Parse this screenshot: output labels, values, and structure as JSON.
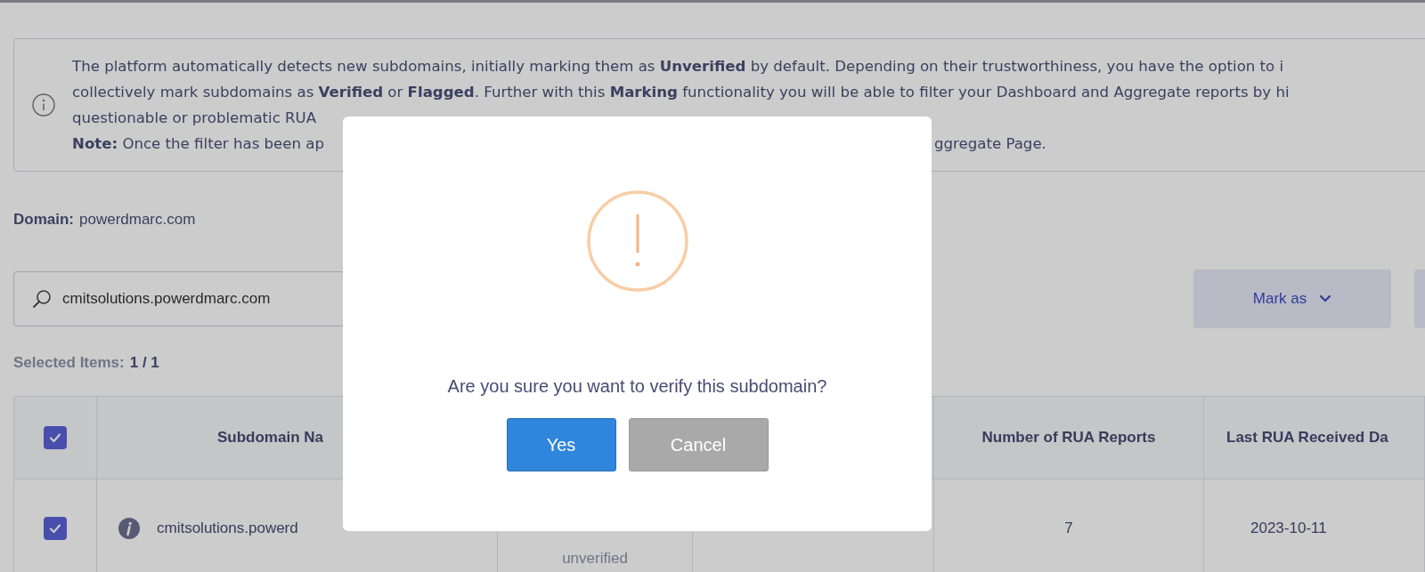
{
  "info_banner": {
    "lines": [
      [
        "The platform automatically detects new subdomains, initially marking them as **Unverified** by default. Depending on their trustworthiness,  you have the option to i"
      ],
      [
        "collectively mark subdomains as **Verified** or **Flagged**. Further with this **Marking** functionality you will be able to filter your Dashboard and Aggregate reports by hi"
      ],
      [
        "questionable or problematic RUA"
      ],
      [
        "**Note:** Once the filter has been ap",
        "ggregate Page."
      ]
    ]
  },
  "domain": {
    "label": "Domain:",
    "value": "powerdmarc.com"
  },
  "search": {
    "value": "cmitsolutions.powerdmarc.com"
  },
  "toolbar": {
    "buttons": [
      {
        "label": "Mark as",
        "kind": "dropdown"
      },
      {
        "kind": "blank"
      }
    ]
  },
  "selected_items": {
    "label": "Selected Items:",
    "value": "1 / 1"
  },
  "table": {
    "header": {
      "checked": true,
      "subdomain": "Subdomain Na",
      "rua_reports": "Number of RUA Reports",
      "last_received": "Last RUA Received Da"
    },
    "rows": [
      {
        "checked": true,
        "subdomain": "cmitsolutions.powerd",
        "status": "unverified",
        "rua_reports": "7",
        "last_received": "2023-10-11"
      }
    ]
  },
  "dialog": {
    "message": "Are you sure you want to verify this subdomain?",
    "buttons": [
      {
        "label": "Yes",
        "kind": "primary"
      },
      {
        "label": "Cancel",
        "kind": "secondary"
      }
    ]
  }
}
